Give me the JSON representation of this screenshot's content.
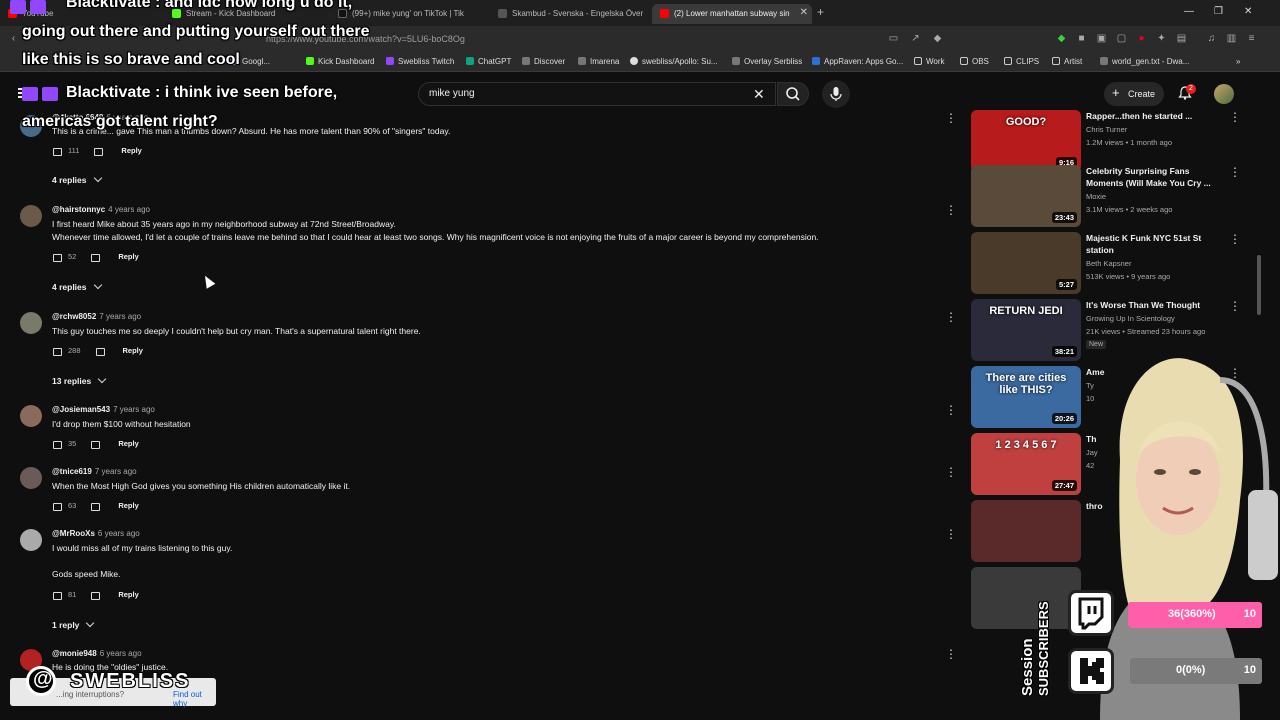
{
  "browser": {
    "tabs": [
      {
        "label": "YouTube",
        "color": "#ff0000"
      },
      {
        "label": "Stream - Kick Dashboard",
        "color": "#53fc18"
      },
      {
        "label": "(99+) mike yung' on TikTok | Tik",
        "color": "#ffffff"
      },
      {
        "label": "Skambud - Svenska - Engelska Över",
        "color": "#555555"
      },
      {
        "label": "(2) Lower manhattan subway sin",
        "color": "#ff0000"
      }
    ],
    "url": "https://www.youtube.com/watch?v=5LU6-boC8Og",
    "bookmarks": [
      {
        "label": "Googl...",
        "color": "#4285f4"
      },
      {
        "label": "Kick Dashboard",
        "color": "#53fc18"
      },
      {
        "label": "Swebliss Twitch",
        "color": "#9146ff"
      },
      {
        "label": "ChatGPT",
        "color": "#10a37f"
      },
      {
        "label": "Discover",
        "color": "#888888"
      },
      {
        "label": "Imarena",
        "color": "#888888"
      },
      {
        "label": "swebliss/Apollo: Su...",
        "color": "#ffffff"
      },
      {
        "label": "Overlay Serbliss",
        "color": "#888888"
      },
      {
        "label": "AppRaven: Apps Go...",
        "color": "#2f6fd6"
      },
      {
        "label": "Work",
        "color": "#d9c28a"
      },
      {
        "label": "OBS",
        "color": "#d9c28a"
      },
      {
        "label": "CLIPS",
        "color": "#d9c28a"
      },
      {
        "label": "Artist",
        "color": "#d9c28a"
      },
      {
        "label": "world_gen.txt - Dwa...",
        "color": "#888888"
      }
    ]
  },
  "youtube": {
    "search_query": "mike yung",
    "create_label": "Create",
    "notifications": "2"
  },
  "comments": [
    {
      "handle": "@skatto.6648",
      "time": "6 years ago",
      "lines": [
        "This is a crime... gave This man a thumbs down? Absurd. He has more talent than 90% of \"singers\" today."
      ],
      "likes": "111",
      "reply": "Reply",
      "replies": "4 replies",
      "avatar": "#4a6a8a"
    },
    {
      "handle": "@hairstonnyc",
      "time": "4 years ago",
      "lines": [
        "I first heard Mike about 35 years ago in my neighborhood subway at 72nd Street/Broadway.",
        "Whenever time allowed, I'd let a couple of trains leave me behind so that I could hear at least two songs. Why his magnificent voice is not enjoying the fruits of a major career is beyond my comprehension."
      ],
      "likes": "52",
      "reply": "Reply",
      "replies": "4 replies",
      "avatar": "#6b5a4a"
    },
    {
      "handle": "@rchw8052",
      "time": "7 years ago",
      "lines": [
        "This guy touches me so deeply I couldn't help but cry man. That's a supernatural talent right there."
      ],
      "likes": "288",
      "reply": "Reply",
      "replies": "13 replies",
      "avatar": "#7a7a6a"
    },
    {
      "handle": "@Josieman543",
      "time": "7 years ago",
      "lines": [
        "I'd drop them $100 without hesitation"
      ],
      "likes": "35",
      "reply": "Reply",
      "replies": "",
      "avatar": "#8a6a5a"
    },
    {
      "handle": "@tnice619",
      "time": "7 years ago",
      "lines": [
        "When the Most High God gives you something His children automatically like it."
      ],
      "likes": "63",
      "reply": "Reply",
      "replies": "",
      "avatar": "#6a5a5a"
    },
    {
      "handle": "@MrRooXs",
      "time": "6 years ago",
      "lines": [
        "I would miss all of my trains listening to this guy.",
        "",
        "Gods speed Mike."
      ],
      "likes": "81",
      "reply": "Reply",
      "replies": "1 reply",
      "avatar": "#aaaaaa"
    },
    {
      "handle": "@monie948",
      "time": "6 years ago",
      "lines": [
        "He is doing the \"oldies\" justice."
      ],
      "likes": "",
      "reply": "",
      "replies": "",
      "avatar": "#b22222"
    }
  ],
  "sidebar": [
    {
      "title": "Rapper...then he started ...",
      "channel": "Chris Turner",
      "meta": "1.2M views • 1 month ago",
      "duration": "9:16",
      "thumb": "#b81b1b",
      "thumb_text": "GOOD?"
    },
    {
      "title": "Celebrity Surprising Fans Moments (Will Make You Cry ...",
      "channel": "Moxie",
      "meta": "3.1M views • 2 weeks ago",
      "duration": "23:43",
      "thumb": "#5a4a3a",
      "thumb_text": ""
    },
    {
      "title": "Majestic K Funk NYC 51st St station",
      "channel": "Beth Kapsner",
      "meta": "513K views • 9 years ago",
      "duration": "5:27",
      "thumb": "#4a3a2a",
      "thumb_text": ""
    },
    {
      "title": "It's Worse Than We Thought",
      "channel": "Growing Up In Scientology",
      "meta": "21K views • Streamed 23 hours ago",
      "duration": "38:21",
      "thumb": "#2a2a3a",
      "thumb_text": "RETURN JEDI",
      "badge": "New"
    },
    {
      "title": "Ame",
      "channel": "Ty",
      "meta": "10",
      "duration": "20:26",
      "thumb": "#3a6aa0",
      "thumb_text": "There are cities like THIS?"
    },
    {
      "title": "Th",
      "channel": "Jay",
      "meta": "42",
      "duration": "27:47",
      "thumb": "#c04040",
      "thumb_text": "1 2 3 4 5 6 7"
    },
    {
      "title": "thro",
      "channel": "",
      "meta": "",
      "duration": "",
      "thumb": "#5a2a2a",
      "thumb_text": ""
    },
    {
      "title": "",
      "channel": "",
      "meta": "",
      "duration": "",
      "thumb": "#3a3a3a",
      "thumb_text": ""
    }
  ],
  "overlay": {
    "chat_lines": [
      "Blacktivate : and idc how long u do it,",
      "going out there and putting yourself out there",
      "like this is so brave and cool",
      "Blacktivate : i think ive seen before,",
      "americas got talent right?"
    ],
    "session_label": "Session",
    "subscribers_label": "SUBSCRIBERS",
    "twitch_goal": "36(360%)",
    "twitch_target": "10",
    "kick_goal": "0(0%)",
    "kick_target": "10",
    "twitch_fraction": 1.0,
    "kick_fraction": 0.0,
    "brand_name": "SWEBLISS",
    "banner_text": "...ing interruptions?",
    "banner_link": "Find out why"
  }
}
